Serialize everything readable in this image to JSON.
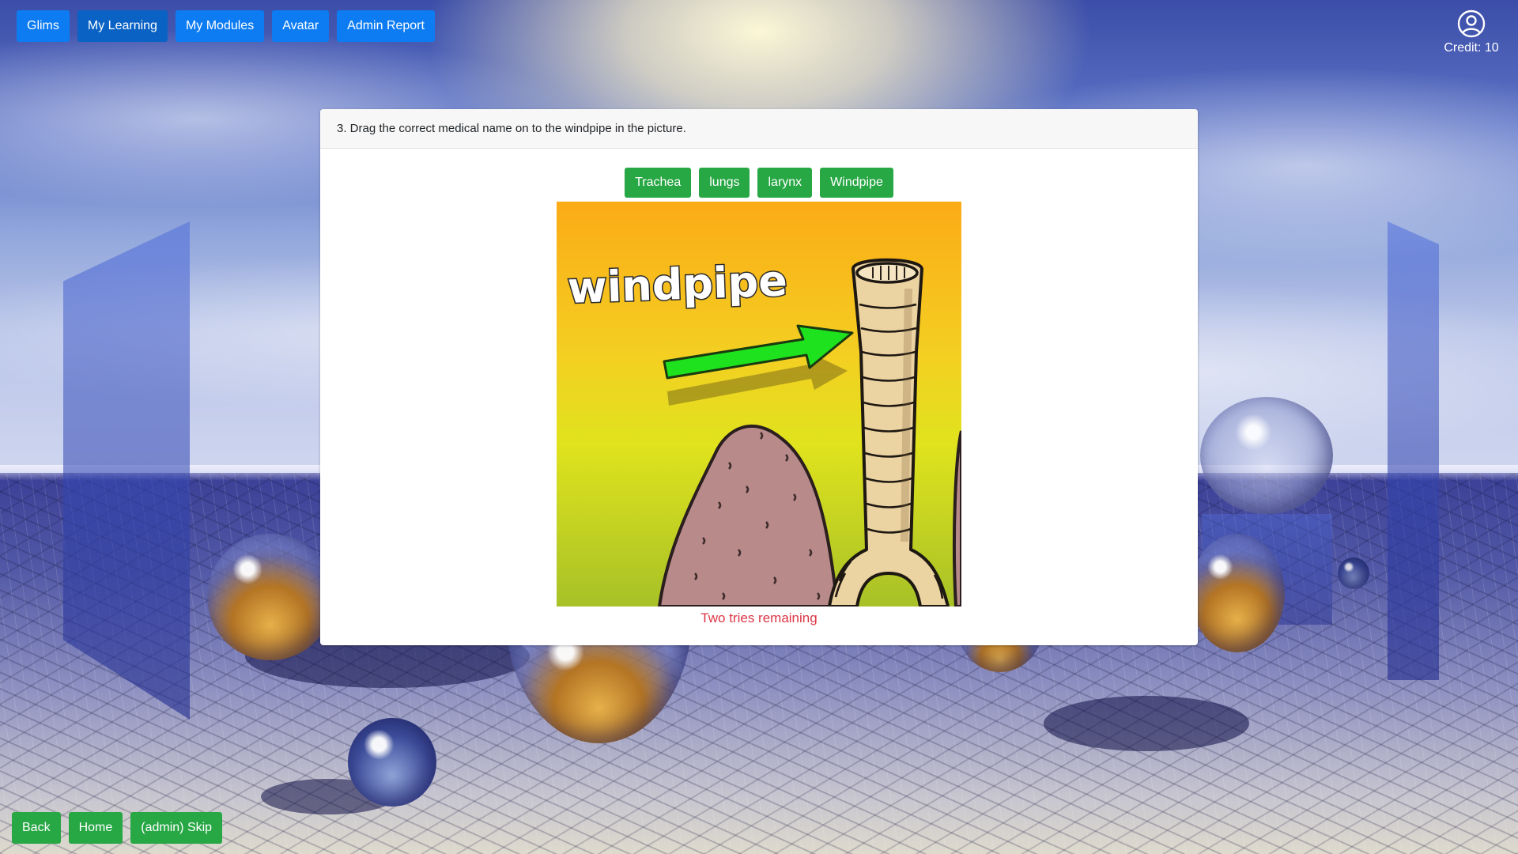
{
  "nav": {
    "items": [
      {
        "label": "Glims",
        "active": false
      },
      {
        "label": "My Learning",
        "active": true
      },
      {
        "label": "My Modules",
        "active": false
      },
      {
        "label": "Avatar",
        "active": false
      },
      {
        "label": "Admin Report",
        "active": false
      }
    ]
  },
  "account": {
    "icon": "user-circle-icon",
    "credit": "Credit: 10"
  },
  "question": {
    "text": "3. Drag the correct medical name on to the windpipe in the picture.",
    "options": [
      "Trachea",
      "lungs",
      "larynx",
      "Windpipe"
    ],
    "image_caption": "windpipe",
    "status": "Two tries remaining"
  },
  "footer": {
    "back_label": "Back",
    "home_label": "Home",
    "skip_label": "(admin) Skip"
  },
  "colors": {
    "primary_button": "#0d7cf2",
    "success_button": "#28a745",
    "status_text": "#dc3545"
  }
}
